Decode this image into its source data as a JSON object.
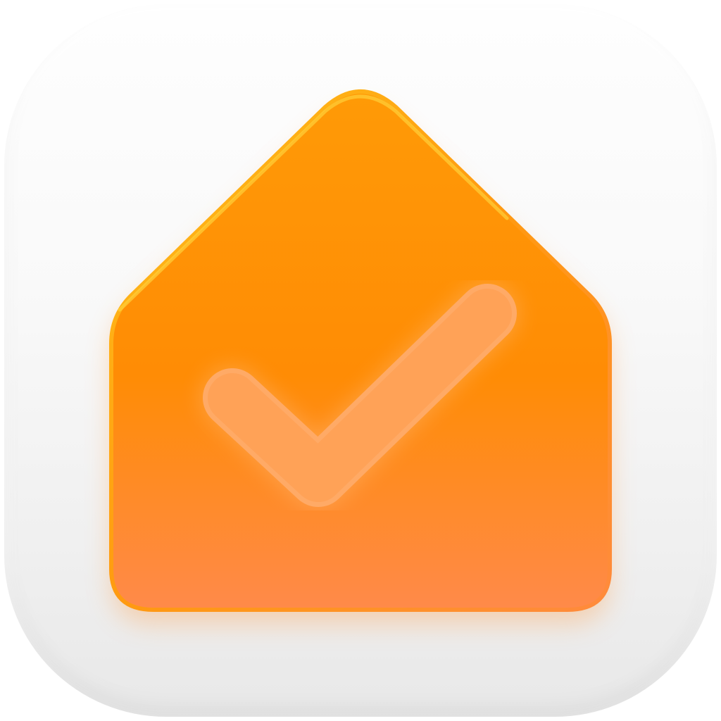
{
  "app_icon": {
    "tile_color": "#f4f4f4",
    "glyph": {
      "shape_icon": "house-icon",
      "mark_icon": "checkmark-icon",
      "house_color_top": "#ffa20a",
      "house_color_bottom": "#ff8a48",
      "check_color": "#ffb07a"
    }
  }
}
